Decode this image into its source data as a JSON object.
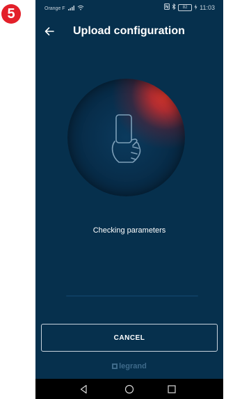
{
  "step": {
    "number": "5",
    "color": "#e3202a"
  },
  "status_bar": {
    "carrier": "Orange F",
    "battery": "82",
    "time": "11:03",
    "icons": [
      "signal-icon",
      "wifi-icon",
      "nfc-icon",
      "bluetooth-icon",
      "battery-icon",
      "charging-icon"
    ]
  },
  "header": {
    "back_icon": "arrow-left-icon",
    "title": "Upload configuration"
  },
  "illustration": {
    "icon": "phone-in-hand-icon"
  },
  "status_text": "Checking parameters",
  "progress": {
    "value": 0.0
  },
  "cancel_label": "CANCEL",
  "brand": "legrand",
  "nav": {
    "icons": [
      "back-nav-icon",
      "home-nav-icon",
      "recents-nav-icon"
    ]
  },
  "colors": {
    "background": "#06304d",
    "accent": "#e1382d",
    "text": "#ffffff"
  }
}
